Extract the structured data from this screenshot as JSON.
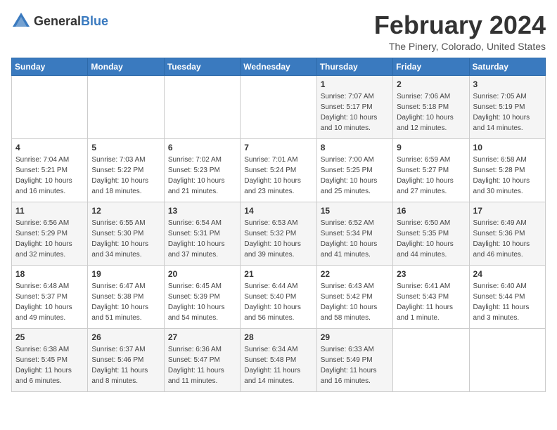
{
  "logo": {
    "text_general": "General",
    "text_blue": "Blue"
  },
  "title": {
    "month": "February 2024",
    "location": "The Pinery, Colorado, United States"
  },
  "header_days": [
    "Sunday",
    "Monday",
    "Tuesday",
    "Wednesday",
    "Thursday",
    "Friday",
    "Saturday"
  ],
  "weeks": [
    [
      {
        "day": "",
        "sunrise": "",
        "sunset": "",
        "daylight": ""
      },
      {
        "day": "",
        "sunrise": "",
        "sunset": "",
        "daylight": ""
      },
      {
        "day": "",
        "sunrise": "",
        "sunset": "",
        "daylight": ""
      },
      {
        "day": "",
        "sunrise": "",
        "sunset": "",
        "daylight": ""
      },
      {
        "day": "1",
        "sunrise": "Sunrise: 7:07 AM",
        "sunset": "Sunset: 5:17 PM",
        "daylight": "Daylight: 10 hours and 10 minutes."
      },
      {
        "day": "2",
        "sunrise": "Sunrise: 7:06 AM",
        "sunset": "Sunset: 5:18 PM",
        "daylight": "Daylight: 10 hours and 12 minutes."
      },
      {
        "day": "3",
        "sunrise": "Sunrise: 7:05 AM",
        "sunset": "Sunset: 5:19 PM",
        "daylight": "Daylight: 10 hours and 14 minutes."
      }
    ],
    [
      {
        "day": "4",
        "sunrise": "Sunrise: 7:04 AM",
        "sunset": "Sunset: 5:21 PM",
        "daylight": "Daylight: 10 hours and 16 minutes."
      },
      {
        "day": "5",
        "sunrise": "Sunrise: 7:03 AM",
        "sunset": "Sunset: 5:22 PM",
        "daylight": "Daylight: 10 hours and 18 minutes."
      },
      {
        "day": "6",
        "sunrise": "Sunrise: 7:02 AM",
        "sunset": "Sunset: 5:23 PM",
        "daylight": "Daylight: 10 hours and 21 minutes."
      },
      {
        "day": "7",
        "sunrise": "Sunrise: 7:01 AM",
        "sunset": "Sunset: 5:24 PM",
        "daylight": "Daylight: 10 hours and 23 minutes."
      },
      {
        "day": "8",
        "sunrise": "Sunrise: 7:00 AM",
        "sunset": "Sunset: 5:25 PM",
        "daylight": "Daylight: 10 hours and 25 minutes."
      },
      {
        "day": "9",
        "sunrise": "Sunrise: 6:59 AM",
        "sunset": "Sunset: 5:27 PM",
        "daylight": "Daylight: 10 hours and 27 minutes."
      },
      {
        "day": "10",
        "sunrise": "Sunrise: 6:58 AM",
        "sunset": "Sunset: 5:28 PM",
        "daylight": "Daylight: 10 hours and 30 minutes."
      }
    ],
    [
      {
        "day": "11",
        "sunrise": "Sunrise: 6:56 AM",
        "sunset": "Sunset: 5:29 PM",
        "daylight": "Daylight: 10 hours and 32 minutes."
      },
      {
        "day": "12",
        "sunrise": "Sunrise: 6:55 AM",
        "sunset": "Sunset: 5:30 PM",
        "daylight": "Daylight: 10 hours and 34 minutes."
      },
      {
        "day": "13",
        "sunrise": "Sunrise: 6:54 AM",
        "sunset": "Sunset: 5:31 PM",
        "daylight": "Daylight: 10 hours and 37 minutes."
      },
      {
        "day": "14",
        "sunrise": "Sunrise: 6:53 AM",
        "sunset": "Sunset: 5:32 PM",
        "daylight": "Daylight: 10 hours and 39 minutes."
      },
      {
        "day": "15",
        "sunrise": "Sunrise: 6:52 AM",
        "sunset": "Sunset: 5:34 PM",
        "daylight": "Daylight: 10 hours and 41 minutes."
      },
      {
        "day": "16",
        "sunrise": "Sunrise: 6:50 AM",
        "sunset": "Sunset: 5:35 PM",
        "daylight": "Daylight: 10 hours and 44 minutes."
      },
      {
        "day": "17",
        "sunrise": "Sunrise: 6:49 AM",
        "sunset": "Sunset: 5:36 PM",
        "daylight": "Daylight: 10 hours and 46 minutes."
      }
    ],
    [
      {
        "day": "18",
        "sunrise": "Sunrise: 6:48 AM",
        "sunset": "Sunset: 5:37 PM",
        "daylight": "Daylight: 10 hours and 49 minutes."
      },
      {
        "day": "19",
        "sunrise": "Sunrise: 6:47 AM",
        "sunset": "Sunset: 5:38 PM",
        "daylight": "Daylight: 10 hours and 51 minutes."
      },
      {
        "day": "20",
        "sunrise": "Sunrise: 6:45 AM",
        "sunset": "Sunset: 5:39 PM",
        "daylight": "Daylight: 10 hours and 54 minutes."
      },
      {
        "day": "21",
        "sunrise": "Sunrise: 6:44 AM",
        "sunset": "Sunset: 5:40 PM",
        "daylight": "Daylight: 10 hours and 56 minutes."
      },
      {
        "day": "22",
        "sunrise": "Sunrise: 6:43 AM",
        "sunset": "Sunset: 5:42 PM",
        "daylight": "Daylight: 10 hours and 58 minutes."
      },
      {
        "day": "23",
        "sunrise": "Sunrise: 6:41 AM",
        "sunset": "Sunset: 5:43 PM",
        "daylight": "Daylight: 11 hours and 1 minute."
      },
      {
        "day": "24",
        "sunrise": "Sunrise: 6:40 AM",
        "sunset": "Sunset: 5:44 PM",
        "daylight": "Daylight: 11 hours and 3 minutes."
      }
    ],
    [
      {
        "day": "25",
        "sunrise": "Sunrise: 6:38 AM",
        "sunset": "Sunset: 5:45 PM",
        "daylight": "Daylight: 11 hours and 6 minutes."
      },
      {
        "day": "26",
        "sunrise": "Sunrise: 6:37 AM",
        "sunset": "Sunset: 5:46 PM",
        "daylight": "Daylight: 11 hours and 8 minutes."
      },
      {
        "day": "27",
        "sunrise": "Sunrise: 6:36 AM",
        "sunset": "Sunset: 5:47 PM",
        "daylight": "Daylight: 11 hours and 11 minutes."
      },
      {
        "day": "28",
        "sunrise": "Sunrise: 6:34 AM",
        "sunset": "Sunset: 5:48 PM",
        "daylight": "Daylight: 11 hours and 14 minutes."
      },
      {
        "day": "29",
        "sunrise": "Sunrise: 6:33 AM",
        "sunset": "Sunset: 5:49 PM",
        "daylight": "Daylight: 11 hours and 16 minutes."
      },
      {
        "day": "",
        "sunrise": "",
        "sunset": "",
        "daylight": ""
      },
      {
        "day": "",
        "sunrise": "",
        "sunset": "",
        "daylight": ""
      }
    ]
  ]
}
